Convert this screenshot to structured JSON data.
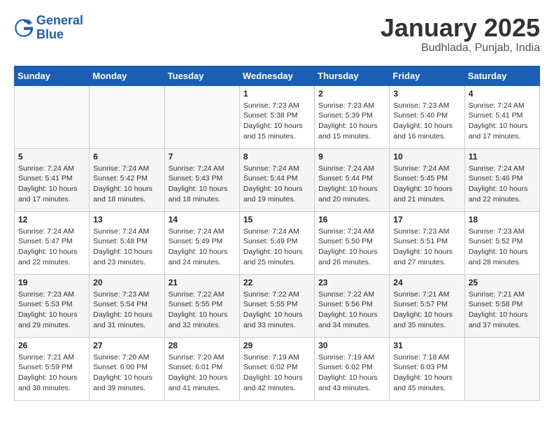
{
  "logo": {
    "line1": "General",
    "line2": "Blue"
  },
  "header": {
    "title": "January 2025",
    "subtitle": "Budhlada, Punjab, India"
  },
  "weekdays": [
    "Sunday",
    "Monday",
    "Tuesday",
    "Wednesday",
    "Thursday",
    "Friday",
    "Saturday"
  ],
  "weeks": [
    [
      {
        "day": "",
        "sunrise": "",
        "sunset": "",
        "daylight": ""
      },
      {
        "day": "",
        "sunrise": "",
        "sunset": "",
        "daylight": ""
      },
      {
        "day": "",
        "sunrise": "",
        "sunset": "",
        "daylight": ""
      },
      {
        "day": "1",
        "sunrise": "Sunrise: 7:23 AM",
        "sunset": "Sunset: 5:38 PM",
        "daylight": "Daylight: 10 hours and 15 minutes."
      },
      {
        "day": "2",
        "sunrise": "Sunrise: 7:23 AM",
        "sunset": "Sunset: 5:39 PM",
        "daylight": "Daylight: 10 hours and 15 minutes."
      },
      {
        "day": "3",
        "sunrise": "Sunrise: 7:23 AM",
        "sunset": "Sunset: 5:40 PM",
        "daylight": "Daylight: 10 hours and 16 minutes."
      },
      {
        "day": "4",
        "sunrise": "Sunrise: 7:24 AM",
        "sunset": "Sunset: 5:41 PM",
        "daylight": "Daylight: 10 hours and 17 minutes."
      }
    ],
    [
      {
        "day": "5",
        "sunrise": "Sunrise: 7:24 AM",
        "sunset": "Sunset: 5:41 PM",
        "daylight": "Daylight: 10 hours and 17 minutes."
      },
      {
        "day": "6",
        "sunrise": "Sunrise: 7:24 AM",
        "sunset": "Sunset: 5:42 PM",
        "daylight": "Daylight: 10 hours and 18 minutes."
      },
      {
        "day": "7",
        "sunrise": "Sunrise: 7:24 AM",
        "sunset": "Sunset: 5:43 PM",
        "daylight": "Daylight: 10 hours and 18 minutes."
      },
      {
        "day": "8",
        "sunrise": "Sunrise: 7:24 AM",
        "sunset": "Sunset: 5:44 PM",
        "daylight": "Daylight: 10 hours and 19 minutes."
      },
      {
        "day": "9",
        "sunrise": "Sunrise: 7:24 AM",
        "sunset": "Sunset: 5:44 PM",
        "daylight": "Daylight: 10 hours and 20 minutes."
      },
      {
        "day": "10",
        "sunrise": "Sunrise: 7:24 AM",
        "sunset": "Sunset: 5:45 PM",
        "daylight": "Daylight: 10 hours and 21 minutes."
      },
      {
        "day": "11",
        "sunrise": "Sunrise: 7:24 AM",
        "sunset": "Sunset: 5:46 PM",
        "daylight": "Daylight: 10 hours and 22 minutes."
      }
    ],
    [
      {
        "day": "12",
        "sunrise": "Sunrise: 7:24 AM",
        "sunset": "Sunset: 5:47 PM",
        "daylight": "Daylight: 10 hours and 22 minutes."
      },
      {
        "day": "13",
        "sunrise": "Sunrise: 7:24 AM",
        "sunset": "Sunset: 5:48 PM",
        "daylight": "Daylight: 10 hours and 23 minutes."
      },
      {
        "day": "14",
        "sunrise": "Sunrise: 7:24 AM",
        "sunset": "Sunset: 5:49 PM",
        "daylight": "Daylight: 10 hours and 24 minutes."
      },
      {
        "day": "15",
        "sunrise": "Sunrise: 7:24 AM",
        "sunset": "Sunset: 5:49 PM",
        "daylight": "Daylight: 10 hours and 25 minutes."
      },
      {
        "day": "16",
        "sunrise": "Sunrise: 7:24 AM",
        "sunset": "Sunset: 5:50 PM",
        "daylight": "Daylight: 10 hours and 26 minutes."
      },
      {
        "day": "17",
        "sunrise": "Sunrise: 7:23 AM",
        "sunset": "Sunset: 5:51 PM",
        "daylight": "Daylight: 10 hours and 27 minutes."
      },
      {
        "day": "18",
        "sunrise": "Sunrise: 7:23 AM",
        "sunset": "Sunset: 5:52 PM",
        "daylight": "Daylight: 10 hours and 28 minutes."
      }
    ],
    [
      {
        "day": "19",
        "sunrise": "Sunrise: 7:23 AM",
        "sunset": "Sunset: 5:53 PM",
        "daylight": "Daylight: 10 hours and 29 minutes."
      },
      {
        "day": "20",
        "sunrise": "Sunrise: 7:23 AM",
        "sunset": "Sunset: 5:54 PM",
        "daylight": "Daylight: 10 hours and 31 minutes."
      },
      {
        "day": "21",
        "sunrise": "Sunrise: 7:22 AM",
        "sunset": "Sunset: 5:55 PM",
        "daylight": "Daylight: 10 hours and 32 minutes."
      },
      {
        "day": "22",
        "sunrise": "Sunrise: 7:22 AM",
        "sunset": "Sunset: 5:55 PM",
        "daylight": "Daylight: 10 hours and 33 minutes."
      },
      {
        "day": "23",
        "sunrise": "Sunrise: 7:22 AM",
        "sunset": "Sunset: 5:56 PM",
        "daylight": "Daylight: 10 hours and 34 minutes."
      },
      {
        "day": "24",
        "sunrise": "Sunrise: 7:21 AM",
        "sunset": "Sunset: 5:57 PM",
        "daylight": "Daylight: 10 hours and 35 minutes."
      },
      {
        "day": "25",
        "sunrise": "Sunrise: 7:21 AM",
        "sunset": "Sunset: 5:58 PM",
        "daylight": "Daylight: 10 hours and 37 minutes."
      }
    ],
    [
      {
        "day": "26",
        "sunrise": "Sunrise: 7:21 AM",
        "sunset": "Sunset: 5:59 PM",
        "daylight": "Daylight: 10 hours and 38 minutes."
      },
      {
        "day": "27",
        "sunrise": "Sunrise: 7:20 AM",
        "sunset": "Sunset: 6:00 PM",
        "daylight": "Daylight: 10 hours and 39 minutes."
      },
      {
        "day": "28",
        "sunrise": "Sunrise: 7:20 AM",
        "sunset": "Sunset: 6:01 PM",
        "daylight": "Daylight: 10 hours and 41 minutes."
      },
      {
        "day": "29",
        "sunrise": "Sunrise: 7:19 AM",
        "sunset": "Sunset: 6:02 PM",
        "daylight": "Daylight: 10 hours and 42 minutes."
      },
      {
        "day": "30",
        "sunrise": "Sunrise: 7:19 AM",
        "sunset": "Sunset: 6:02 PM",
        "daylight": "Daylight: 10 hours and 43 minutes."
      },
      {
        "day": "31",
        "sunrise": "Sunrise: 7:18 AM",
        "sunset": "Sunset: 6:03 PM",
        "daylight": "Daylight: 10 hours and 45 minutes."
      },
      {
        "day": "",
        "sunrise": "",
        "sunset": "",
        "daylight": ""
      }
    ]
  ]
}
